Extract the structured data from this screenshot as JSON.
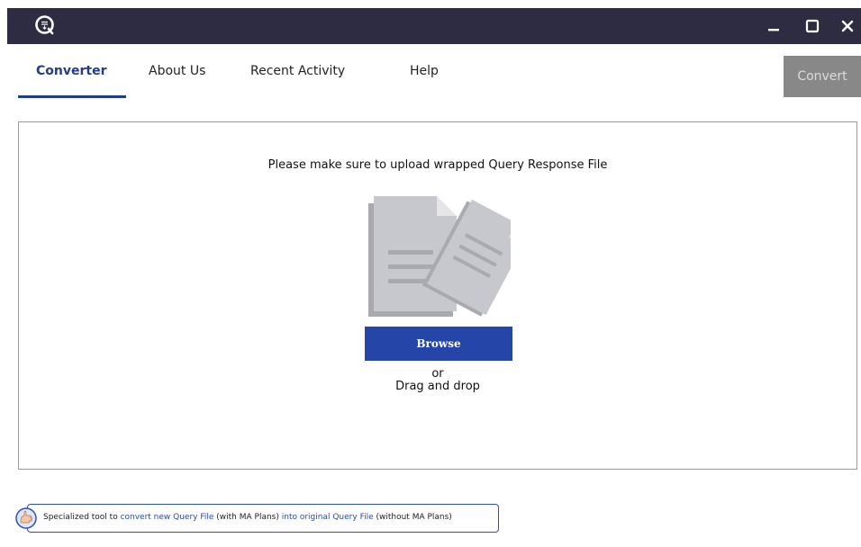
{
  "window": {
    "logo_icon": "query-logo-icon",
    "controls": {
      "minimize_icon": "minimize-icon",
      "maximize_icon": "maximize-icon",
      "close_icon": "close-icon"
    }
  },
  "nav": {
    "tabs": [
      {
        "label": "Converter",
        "active": true
      },
      {
        "label": "About Us",
        "active": false
      },
      {
        "label": "Recent Activity",
        "active": false
      },
      {
        "label": "Help",
        "active": false
      }
    ],
    "convert_label": "Convert"
  },
  "upload": {
    "message": "Please make sure to upload wrapped Query Response File",
    "illustration_icon": "documents-icon",
    "browse_label": "Browse",
    "or_label": "or",
    "drag_label": "Drag and drop"
  },
  "footer": {
    "icon": "hand-icon",
    "parts": [
      {
        "text": "Specialized tool to ",
        "highlight": false
      },
      {
        "text": "convert new Query File",
        "highlight": true
      },
      {
        "text": " (with MA Plans) ",
        "highlight": false
      },
      {
        "text": "into original Query File",
        "highlight": true
      },
      {
        "text": " (without MA Plans)",
        "highlight": false
      }
    ]
  },
  "colors": {
    "titlebar": "#2d2c43",
    "accent": "#233d8c",
    "browse": "#2545a8",
    "convert_disabled": "#888888"
  }
}
